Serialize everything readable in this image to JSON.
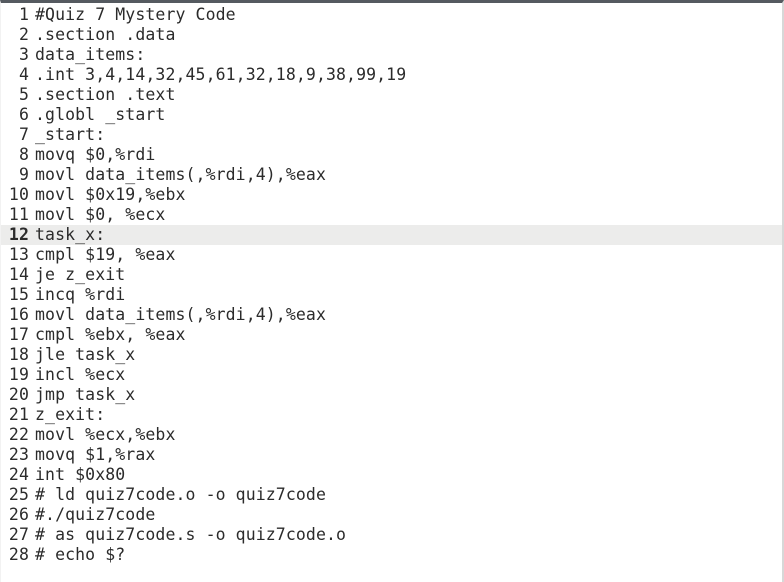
{
  "editor": {
    "title": "Quiz 7 Mystery Code",
    "language": "assembly",
    "current_line": 12,
    "text_color": "#2b2b2b",
    "background_color": "#ffffff",
    "current_line_highlight_color": "#ececeb",
    "lines": [
      {
        "number": "1",
        "text": "#Quiz 7 Mystery Code"
      },
      {
        "number": "2",
        "text": ".section .data"
      },
      {
        "number": "3",
        "text": "data_items:"
      },
      {
        "number": "4",
        "text": ".int 3,4,14,32,45,61,32,18,9,38,99,19"
      },
      {
        "number": "5",
        "text": ".section .text"
      },
      {
        "number": "6",
        "text": ".globl _start"
      },
      {
        "number": "7",
        "text": "_start:"
      },
      {
        "number": "8",
        "text": "movq $0,%rdi"
      },
      {
        "number": "9",
        "text": "movl data_items(,%rdi,4),%eax"
      },
      {
        "number": "10",
        "text": "movl $0x19,%ebx"
      },
      {
        "number": "11",
        "text": "movl $0, %ecx"
      },
      {
        "number": "12",
        "text": "task_x:"
      },
      {
        "number": "13",
        "text": "cmpl $19, %eax"
      },
      {
        "number": "14",
        "text": "je z_exit"
      },
      {
        "number": "15",
        "text": "incq %rdi"
      },
      {
        "number": "16",
        "text": "movl data_items(,%rdi,4),%eax"
      },
      {
        "number": "17",
        "text": "cmpl %ebx, %eax"
      },
      {
        "number": "18",
        "text": "jle task_x"
      },
      {
        "number": "19",
        "text": "incl %ecx"
      },
      {
        "number": "20",
        "text": "jmp task_x"
      },
      {
        "number": "21",
        "text": "z_exit:"
      },
      {
        "number": "22",
        "text": "movl %ecx,%ebx"
      },
      {
        "number": "23",
        "text": "movq $1,%rax"
      },
      {
        "number": "24",
        "text": "int $0x80"
      },
      {
        "number": "25",
        "text": "# ld quiz7code.o -o quiz7code"
      },
      {
        "number": "26",
        "text": "#./quiz7code"
      },
      {
        "number": "27",
        "text": "# as quiz7code.s -o quiz7code.o"
      },
      {
        "number": "28",
        "text": "# echo $?"
      }
    ]
  }
}
